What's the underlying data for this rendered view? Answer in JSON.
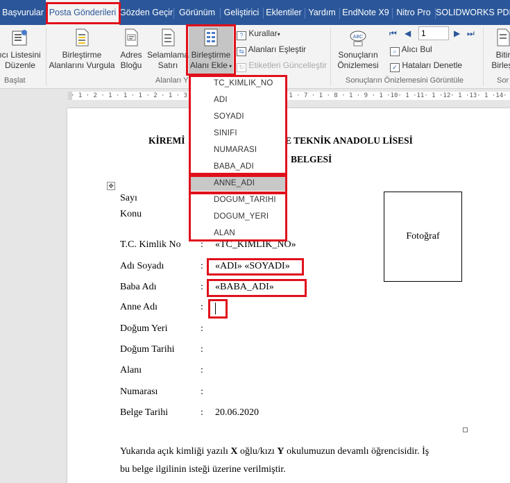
{
  "tabs": [
    {
      "label": "Başvurular"
    },
    {
      "label": "Posta Gönderileri",
      "active": true
    },
    {
      "label": "Gözden Geçir"
    },
    {
      "label": "Görünüm"
    },
    {
      "label": "Geliştirici"
    },
    {
      "label": "Eklentiler"
    },
    {
      "label": "Yardım"
    },
    {
      "label": "EndNote X9"
    },
    {
      "label": "Nitro Pro"
    },
    {
      "label": "SOLIDWORKS PDM"
    }
  ],
  "ribbon": {
    "recipient_list": {
      "line1": "ıcı Listesini",
      "line2": "Düzenle"
    },
    "start_group_label": "Başlat",
    "highlight_fields": {
      "line1": "Birleştirme",
      "line2": "Alanlarını Vurgula"
    },
    "address_block": {
      "line1": "Adres",
      "line2": "Bloğu"
    },
    "greeting_line": {
      "line1": "Selamlama",
      "line2": "Satırı"
    },
    "insert_field": {
      "line1": "Birleştirme",
      "line2": "Alanı Ekle"
    },
    "rules": "Kurallar",
    "match_fields": "Alanları Eşleştir",
    "update_labels": "Etiketleri Güncelleştir",
    "write_group_label": "Alanları Y",
    "preview_results": {
      "line1": "Sonuçların",
      "line2": "Önizlemesi"
    },
    "record_number": "1",
    "find_recipient": "Alıcı Bul",
    "check_errors": "Hataları Denetle",
    "preview_group_label": "Sonuçların Önizlemesini Görüntüle",
    "finish": {
      "line1": "Bitir",
      "line2": "Birleşt"
    },
    "finish_group_label": "Sor"
  },
  "ruler_text": "· 1 · 2 · 1 · 1 · 1 · 2 · 1 · 3 · 1 · 4 · 1 · 5 · 1 · 6 · 1 · 7 · 1 · 8 · 1 · 9 · 1 ·10· 1 ·11· 1 ·12· 1 ·13· 1 ·14· 1 ·15· △ ·16· 1 ·17· 1 ·18· 1",
  "merge_fields": [
    {
      "label": "TC_KIMLIK_NO"
    },
    {
      "label": "ADI"
    },
    {
      "label": "SOYADI"
    },
    {
      "label": "SINIFI"
    },
    {
      "label": "NUMARASI"
    },
    {
      "label": "BABA_ADI"
    },
    {
      "label": "ANNE_ADI",
      "selected": true
    },
    {
      "label": "DOGUM_TARIHI"
    },
    {
      "label": "DOGUM_YERI"
    },
    {
      "label": "ALAN"
    }
  ],
  "document": {
    "title_left": "KİREMİ",
    "title_right": "E TEKNİK ANADOLU LİSESİ",
    "subtitle": "BELGESİ",
    "sayi_label": "Sayı",
    "konu_label": "Konu",
    "photo_label": "Fotoğraf",
    "colon": ":",
    "rows": [
      {
        "label": "T.C. Kimlik No",
        "value": "«TC_KIMLIK_NO»"
      },
      {
        "label": "Adı Soyadı",
        "value": "«ADI» «SOYADI»"
      },
      {
        "label": "Baba Adı",
        "value": "«BABA_ADI»"
      },
      {
        "label": "Anne Adı",
        "value": ""
      },
      {
        "label": "Doğum Yeri",
        "value": ""
      },
      {
        "label": "Doğum Tarihi",
        "value": ""
      },
      {
        "label": "Alanı",
        "value": ""
      },
      {
        "label": "Numarası",
        "value": ""
      },
      {
        "label": "Belge Tarihi",
        "value": "20.06.2020"
      }
    ],
    "paragraph_1_a": "Yukarıda açık kimliği yazılı ",
    "paragraph_1_x": "X",
    "paragraph_1_b": " oğlu/kızı ",
    "paragraph_1_y": "Y",
    "paragraph_1_c": " okulumuzun devamlı öğrencisidir. İş",
    "paragraph_2": "bu belge ilgilinin isteği üzerine verilmiştir."
  },
  "colors": {
    "tabbar": "#2b579a",
    "highlight": "#e0101b",
    "ribbon": "#f3f3f3"
  }
}
